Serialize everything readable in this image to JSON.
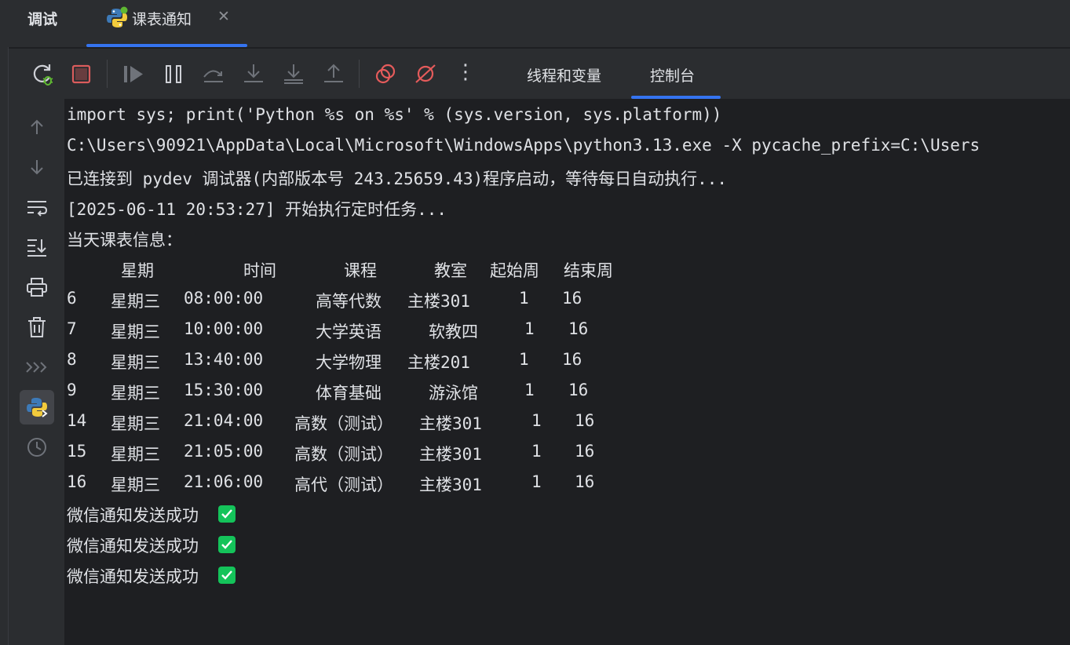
{
  "header": {
    "debug_title": "调试",
    "tab_label": "课表通知",
    "close_glyph": "✕"
  },
  "toolbar": {
    "icons": [
      "rerun-debug-icon",
      "stop-icon",
      "resume-icon",
      "pause-icon",
      "step-over-icon",
      "step-into-icon",
      "force-step-into-icon",
      "step-out-icon",
      "view-breakpoints-icon",
      "mute-breakpoints-icon",
      "more-icon"
    ],
    "tabs": [
      "线程和变量",
      "控制台"
    ],
    "active_tab": "控制台",
    "more_glyph": "⋮"
  },
  "gutter": {
    "icons": [
      "up-arrow-icon",
      "down-arrow-icon",
      "soft-wrap-icon",
      "scroll-to-end-icon",
      "print-icon",
      "trash-icon",
      "show-command-icon",
      "python-console-icon",
      "history-icon"
    ]
  },
  "console": {
    "lines": [
      "import sys; print('Python %s on %s' % (sys.version, sys.platform))",
      "C:\\Users\\90921\\AppData\\Local\\Microsoft\\WindowsApps\\python3.13.exe -X pycache_prefix=C:\\Users",
      "已连接到 pydev 调试器(内部版本号 243.25659.43)程序启动，等待每日自动执行...",
      "[2025-06-11 20:53:27] 开始执行定时任务...",
      "当天课表信息："
    ],
    "table_headers": [
      "星期",
      "时间",
      "课程",
      "教室",
      "起始周",
      "结束周"
    ],
    "table_rows": [
      [
        "6",
        "星期三",
        "08:00:00",
        "高等代数",
        "主楼301",
        "1",
        "16"
      ],
      [
        "7",
        "星期三",
        "10:00:00",
        "大学英语",
        "软教四",
        "1",
        "16"
      ],
      [
        "8",
        "星期三",
        "13:40:00",
        "大学物理",
        "主楼201",
        "1",
        "16"
      ],
      [
        "9",
        "星期三",
        "15:30:00",
        "体育基础",
        "游泳馆",
        "1",
        "16"
      ],
      [
        "14",
        "星期三",
        "21:04:00",
        "高数（测试）",
        "主楼301",
        "1",
        "16"
      ],
      [
        "15",
        "星期三",
        "21:05:00",
        "高数（测试）",
        "主楼301",
        "1",
        "16"
      ],
      [
        "16",
        "星期三",
        "21:06:00",
        "高代（测试）",
        "主楼301",
        "1",
        "16"
      ]
    ],
    "notifications": [
      "微信通知发送成功",
      "微信通知发送成功",
      "微信通知发送成功"
    ]
  },
  "colors": {
    "accent": "#3574f0",
    "stop_red": "#db5c5c",
    "breakpoint_red": "#e55b5b",
    "success_green": "#14c35a",
    "background": "#1e1f22",
    "panel": "#2b2d30"
  }
}
